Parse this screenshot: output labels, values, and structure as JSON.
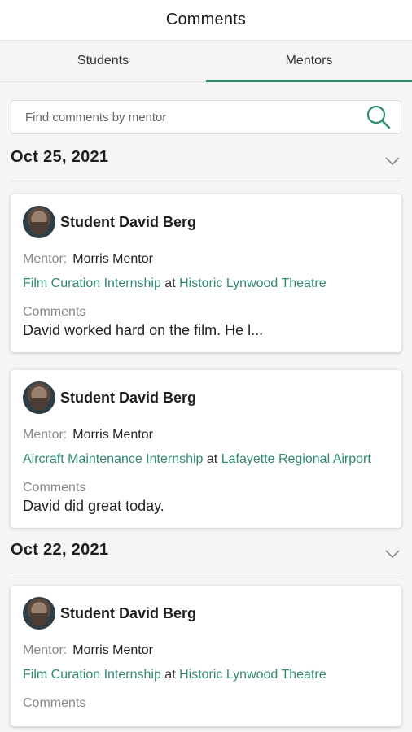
{
  "header": {
    "title": "Comments"
  },
  "tabs": [
    {
      "label": "Students",
      "active": false
    },
    {
      "label": "Mentors",
      "active": true
    }
  ],
  "search": {
    "placeholder": "Find comments by mentor"
  },
  "groups": [
    {
      "date": "Oct 25, 2021",
      "cards": [
        {
          "student": "Student David Berg",
          "mentor_label": "Mentor:",
          "mentor": "Morris Mentor",
          "internship": "Film Curation Internship",
          "at": "at",
          "location": "Historic Lynwood Theatre",
          "comments_label": "Comments",
          "comment": "David worked hard on the film. He l..."
        },
        {
          "student": "Student David Berg",
          "mentor_label": "Mentor:",
          "mentor": "Morris Mentor",
          "internship": "Aircraft Maintenance Internship",
          "at": "at",
          "location": "Lafayette Regional Airport",
          "comments_label": "Comments",
          "comment": "David did great today."
        }
      ]
    },
    {
      "date": "Oct 22, 2021",
      "cards": [
        {
          "student": "Student David Berg",
          "mentor_label": "Mentor:",
          "mentor": "Morris Mentor",
          "internship": "Film Curation Internship",
          "at": "at",
          "location": "Historic Lynwood Theatre",
          "comments_label": "Comments",
          "comment": ""
        }
      ]
    }
  ],
  "colors": {
    "accent": "#2f8a72",
    "background": "#f5f5f5"
  },
  "icons": {
    "search": "search-icon",
    "collapse": "chevron-down-icon"
  }
}
